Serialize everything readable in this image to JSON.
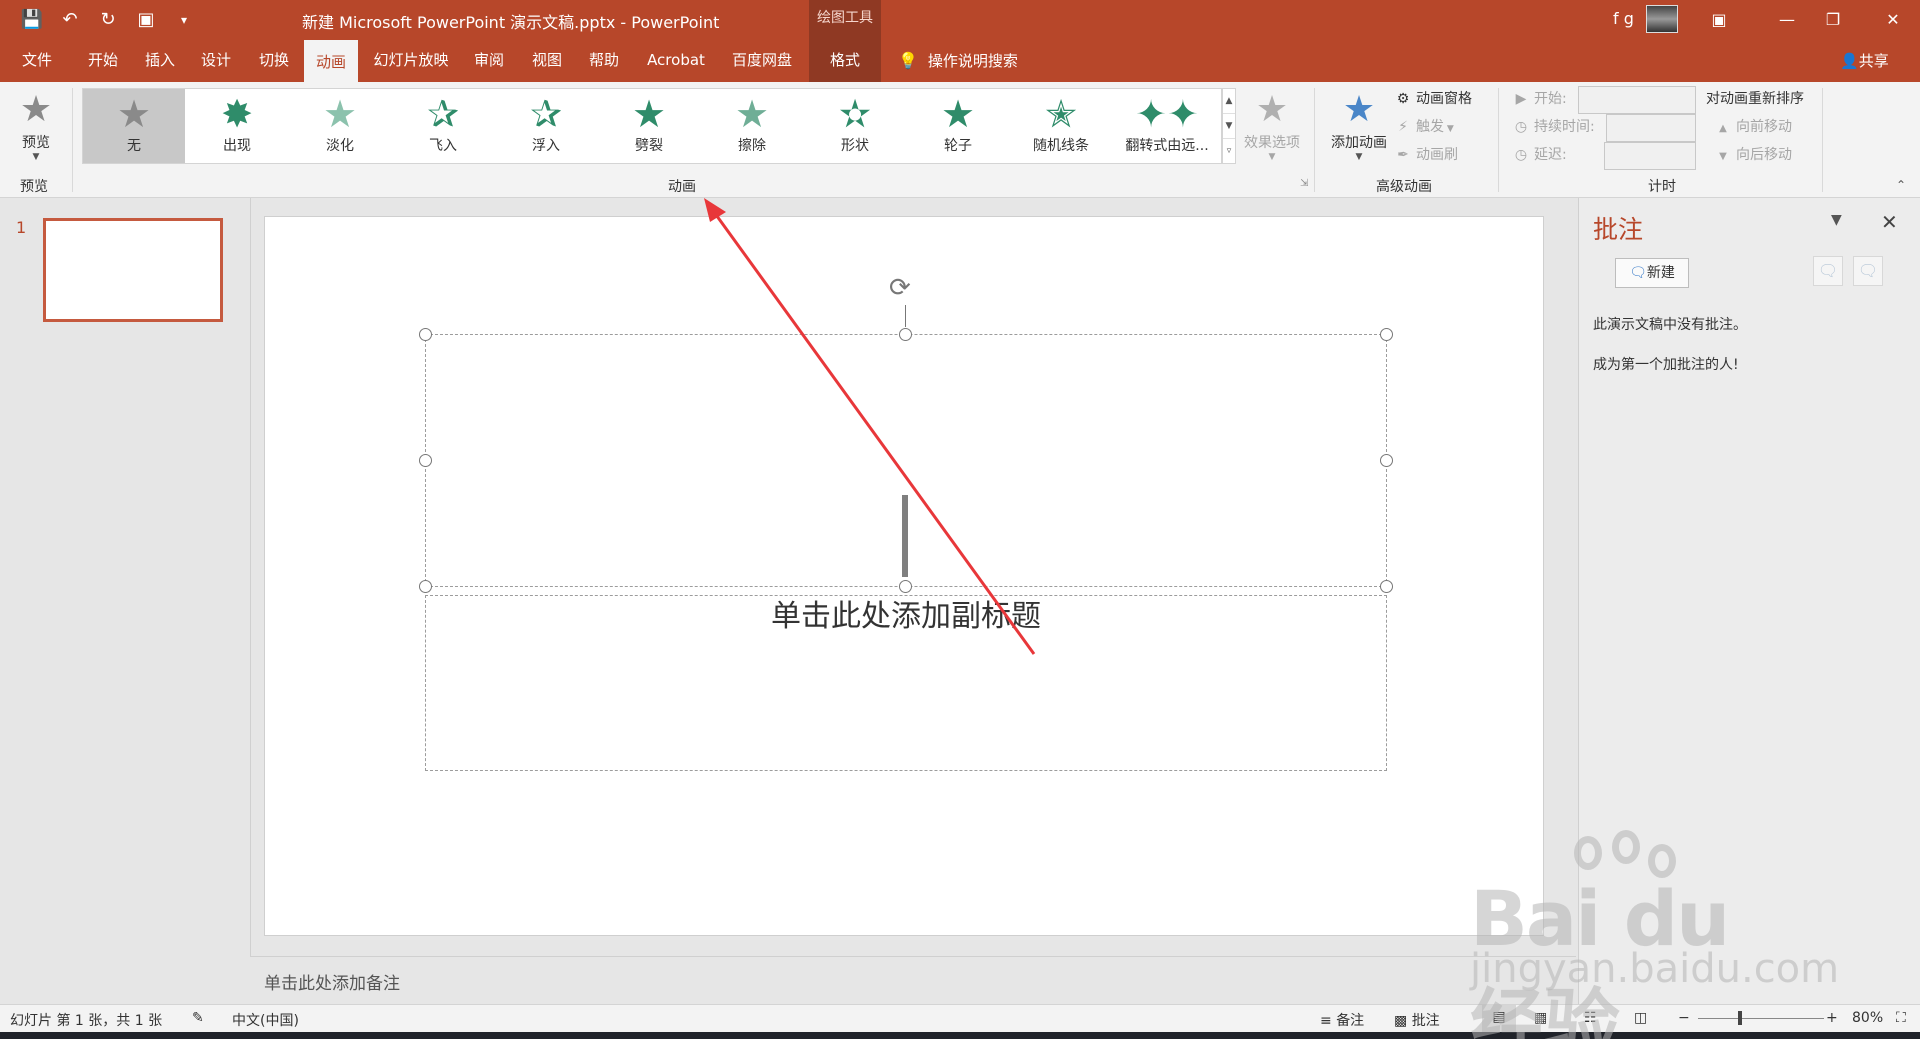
{
  "window": {
    "title": "新建 Microsoft PowerPoint 演示文稿.pptx  -  PowerPoint",
    "contextual_tab_group": "绘图工具",
    "user_name": "f g"
  },
  "quick_access": [
    "save-icon",
    "undo-icon",
    "redo-icon",
    "start-from-beginning-icon",
    "customize-icon"
  ],
  "tabs": [
    {
      "label": "文件"
    },
    {
      "label": "开始"
    },
    {
      "label": "插入"
    },
    {
      "label": "设计"
    },
    {
      "label": "切换"
    },
    {
      "label": "动画"
    },
    {
      "label": "幻灯片放映"
    },
    {
      "label": "审阅"
    },
    {
      "label": "视图"
    },
    {
      "label": "帮助"
    },
    {
      "label": "Acrobat"
    },
    {
      "label": "百度网盘"
    },
    {
      "label": "格式"
    }
  ],
  "active_tab": "动画",
  "tell_me": "操作说明搜索",
  "share": "共享",
  "ribbon": {
    "preview_group": {
      "button": "预览",
      "label": "预览"
    },
    "animation_gallery": {
      "items": [
        "无",
        "出现",
        "淡化",
        "飞入",
        "浮入",
        "劈裂",
        "擦除",
        "形状",
        "轮子",
        "随机线条",
        "翻转式由远..."
      ],
      "selected": "无"
    },
    "effect_options": "效果选项",
    "animation_group_label": "动画",
    "advanced": {
      "add_animation": "添加动画",
      "animation_pane": "动画窗格",
      "trigger": "触发",
      "painter": "动画刷",
      "label": "高级动画"
    },
    "timing": {
      "start": "开始:",
      "duration": "持续时间:",
      "delay": "延迟:",
      "reorder": "对动画重新排序",
      "move_earlier": "向前移动",
      "move_later": "向后移动",
      "label": "计时"
    }
  },
  "slides": [
    {
      "number": "1"
    }
  ],
  "slide": {
    "subtitle_placeholder": "单击此处添加副标题"
  },
  "notes_placeholder": "单击此处添加备注",
  "comments_pane": {
    "title": "批注",
    "new_button": "新建",
    "empty_message": "此演示文稿中没有批注。",
    "prompt": "成为第一个加批注的人!"
  },
  "statusbar": {
    "slide_info": "幻灯片 第 1 张，共 1 张",
    "language": "中文(中国)",
    "notes": "备注",
    "comments": "批注",
    "zoom": "80%"
  },
  "watermark": {
    "brand": "Bai du 经验",
    "url": "jingyan.baidu.com"
  },
  "colors": {
    "accent": "#b7472a",
    "accent_dark": "#8f3923",
    "ribbon_bg": "#f3f3f3",
    "star_green": "#2f8c6a",
    "arrow_red": "#e8373a"
  }
}
